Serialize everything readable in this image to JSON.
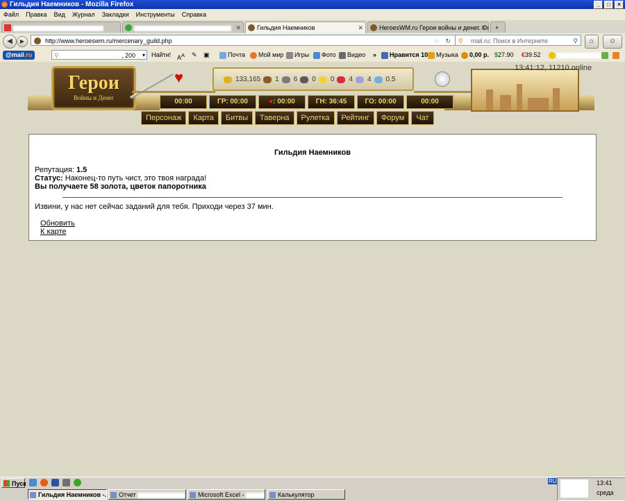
{
  "window": {
    "title": "Гильдия Наемников - Mozilla Firefox"
  },
  "menubar": [
    "Файл",
    "Правка",
    "Вид",
    "Журнал",
    "Закладки",
    "Инструменты",
    "Справка"
  ],
  "tabs": [
    {
      "label": ""
    },
    {
      "label": ""
    },
    {
      "label": "Гильдия Наемников"
    },
    {
      "label": "HeroesWM.ru Герои войны и денег. Он..."
    }
  ],
  "nav": {
    "url": "http://www.heroeswm.ru/mercenary_guild.php",
    "search_placeholder": "mail.ru: Поиск в Интернете"
  },
  "mailbar": {
    "logo_left": "@mail",
    "logo_right": ".ru",
    "search_value": ", 200",
    "find": "Найти!",
    "mail": "Почта",
    "mymir": "Мой мир",
    "games": "Игры",
    "photo": "Фото",
    "video": "Видео",
    "more": "»",
    "likes": "Нравится 10",
    "music": "Музыка",
    "money": "0,00 р.",
    "usd": "27.90",
    "eur": "39.52"
  },
  "game": {
    "online": "13:41:12, 11210 online",
    "logo_title": "Герои",
    "logo_sub": "Войны и Денег",
    "resources": [
      "133,165",
      "1",
      "6",
      "0",
      "0",
      "4",
      "4",
      "0.5"
    ],
    "timers": [
      {
        "label": "00:00"
      },
      {
        "label": "ГР: 00:00"
      },
      {
        "label": ": 00:00"
      },
      {
        "label": "ГН: 36:45"
      },
      {
        "label": "ГО: 00:00"
      },
      {
        "label": "00:00"
      }
    ],
    "menu": [
      "Персонаж",
      "Карта",
      "Битвы",
      "Таверна",
      "Рулетка",
      "Рейтинг",
      "Форум",
      "Чат"
    ]
  },
  "content": {
    "heading": "Гильдия Наемников",
    "reputation_label": "Репутация:",
    "reputation_value": "1.5",
    "status_label": "Статус:",
    "status_value": "Наконец-то путь чист, это твоя награда!",
    "reward": "Вы получаете 58 золота, цветок папоротника",
    "message": "Извини, у нас нет сейчас заданий для тебя. Приходи через 37 мин.",
    "link_refresh": "Обновить",
    "link_map": "К карте"
  },
  "taskbar": {
    "start": "Пуск",
    "tasks": [
      "Гильдия Наемников -...",
      "Отчет",
      "Microsoft Excel -",
      "Калькулятор"
    ],
    "lang": "RU",
    "time": "13:41",
    "day": "среда"
  }
}
